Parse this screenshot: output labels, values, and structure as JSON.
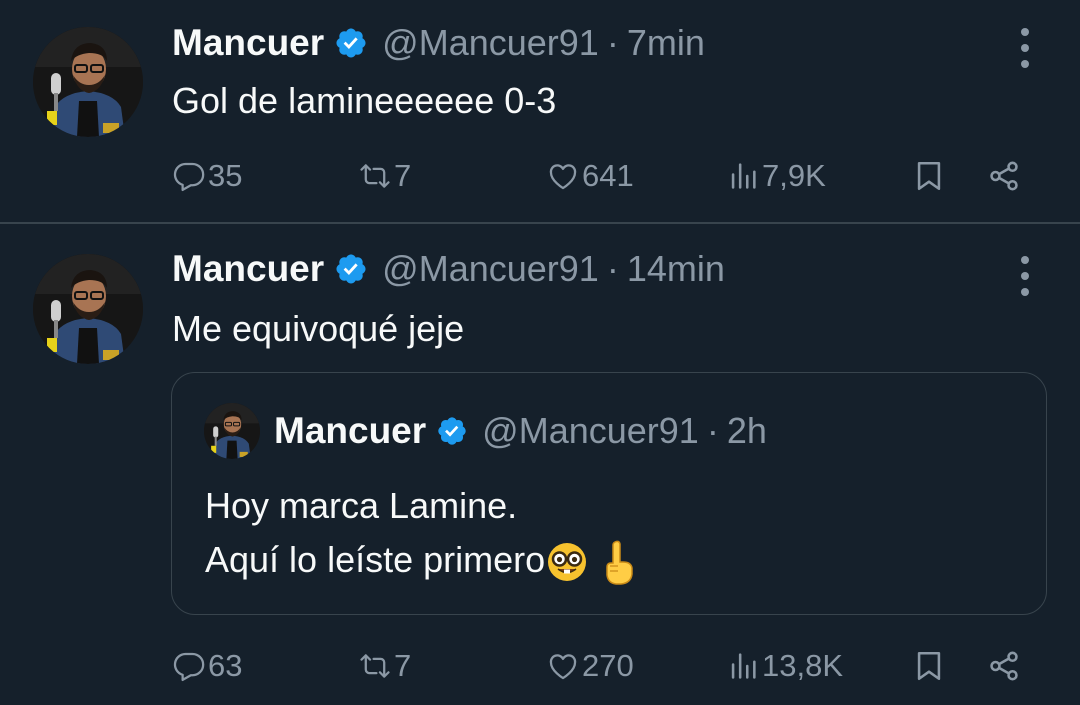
{
  "tweets": [
    {
      "name": "Mancuer",
      "handle": "@Mancuer91",
      "separator": "·",
      "time": "7min",
      "text": "Gol de lamineeeeee 0-3",
      "actions": {
        "replies": "35",
        "retweets": "7",
        "likes": "641",
        "views": "7,9K"
      }
    },
    {
      "name": "Mancuer",
      "handle": "@Mancuer91",
      "separator": "·",
      "time": "14min",
      "text": "Me equivoqué jeje",
      "quote": {
        "name": "Mancuer",
        "handle": "@Mancuer91",
        "separator": "·",
        "time": "2h",
        "line1": "Hoy marca Lamine.",
        "line2": "Aquí lo leíste primero"
      },
      "actions": {
        "replies": "63",
        "retweets": "7",
        "likes": "270",
        "views": "13,8K"
      }
    }
  ],
  "colors": {
    "background": "#15202b",
    "text_primary": "#f7f9f9",
    "text_secondary": "#8b98a5",
    "border": "#38444d",
    "verified": "#1d9bf0"
  },
  "icons": [
    "verified-badge-icon",
    "more-options-icon",
    "reply-icon",
    "retweet-icon",
    "like-icon",
    "views-icon",
    "bookmark-icon",
    "share-icon",
    "nerd-face-emoji",
    "pointing-up-emoji"
  ]
}
